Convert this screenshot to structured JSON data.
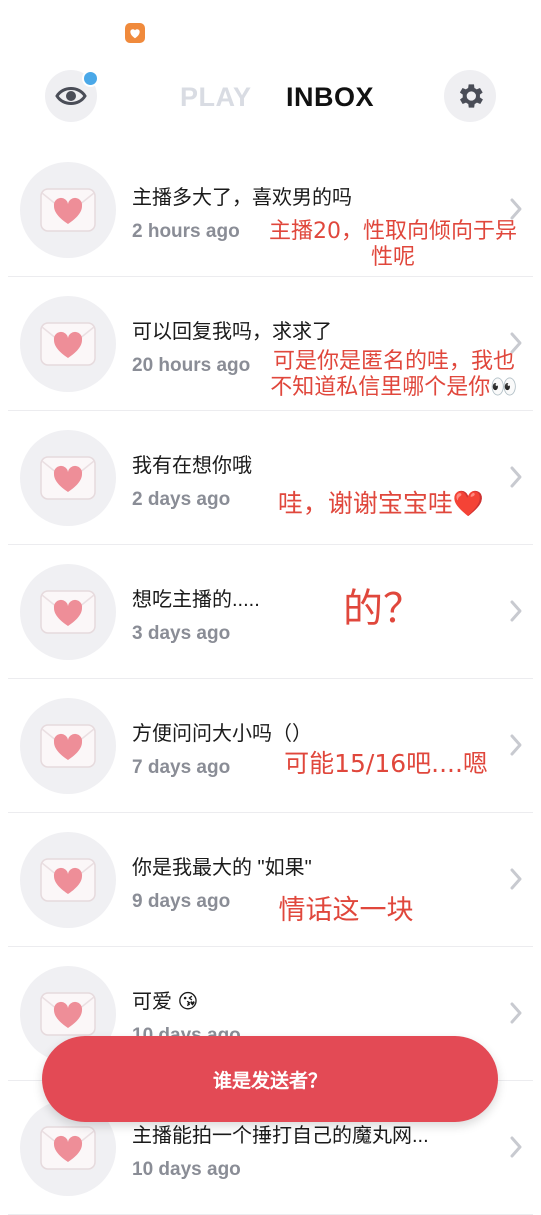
{
  "header": {
    "tabs": [
      {
        "label": "PLAY",
        "active": false
      },
      {
        "label": "INBOX",
        "active": true
      }
    ],
    "eye_icon": "eye-icon",
    "settings_icon": "gear-icon",
    "notification_dot_color": "#4aa8e8"
  },
  "messages": [
    {
      "title": "主播多大了，喜欢男的吗",
      "time": "2 hours ago",
      "note": "主播20，性取向倾向于异\n性呢"
    },
    {
      "title": "可以回复我吗，求求了",
      "time": "20 hours ago",
      "note": "可是你是匿名的哇，我也\n不知道私信里哪个是你👀"
    },
    {
      "title": "我有在想你哦",
      "time": "2 days ago",
      "note": "哇，谢谢宝宝哇❤️"
    },
    {
      "title": "想吃主播的.....",
      "time": "3 days ago",
      "note": "的？"
    },
    {
      "title": "方便问问大小吗（）",
      "time": "7 days ago",
      "note": "可能15/16吧....嗯"
    },
    {
      "title": "你是我最大的 \"如果\"",
      "time": "9 days ago",
      "note": "情话这一块"
    },
    {
      "title": "可爱 😘",
      "time": "10 days ago",
      "note": ""
    },
    {
      "title": "主播能拍一个捶打自己的魔丸网...",
      "time": "10 days ago",
      "note": ""
    }
  ],
  "cta": {
    "label": "谁是发送者？"
  },
  "colors": {
    "accent": "#e34a55",
    "annotation": "#e0473c",
    "heart": "#ee8e98"
  }
}
